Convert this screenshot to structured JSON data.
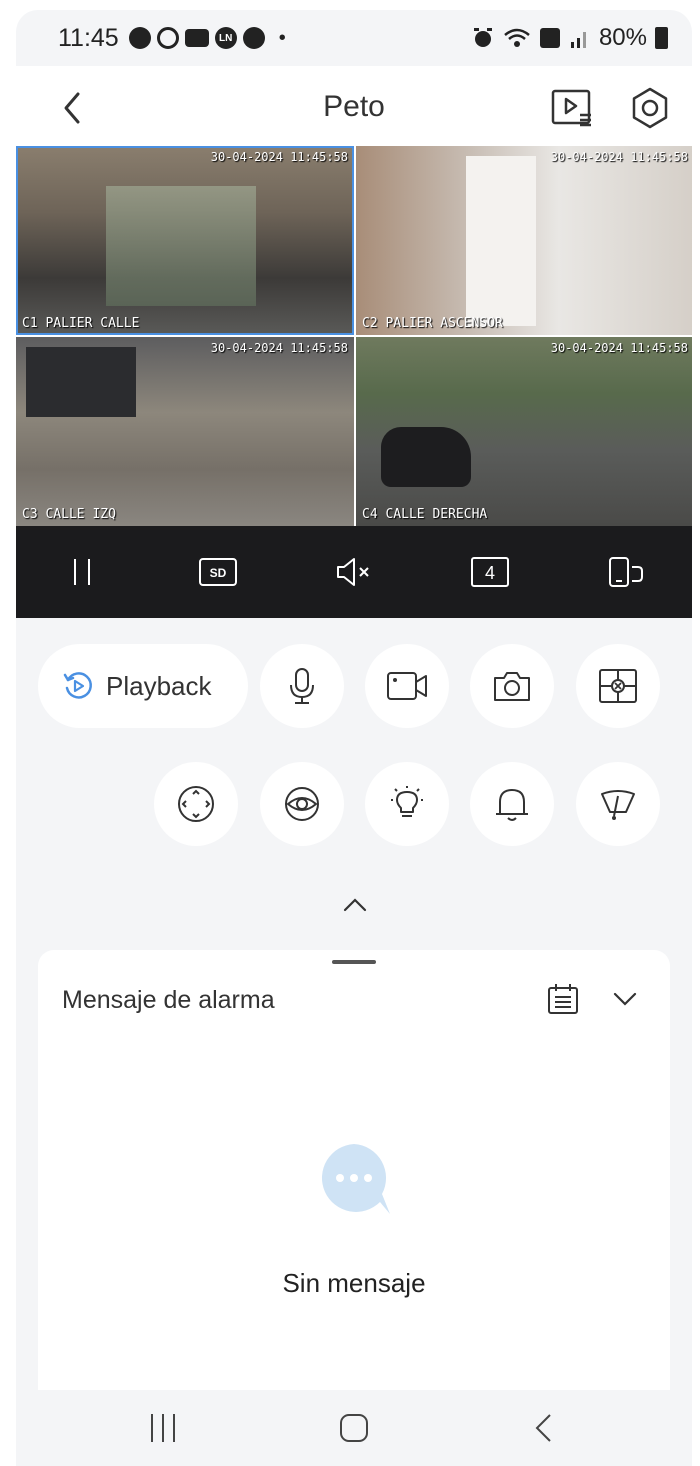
{
  "status_bar": {
    "time": "11:45",
    "battery": "80%",
    "icons": [
      "chat-icon",
      "cloud-icon",
      "youtube-icon",
      "ln-icon",
      "settings-icon",
      "alarm-icon",
      "wifi-icon",
      "volte-icon",
      "signal-icon",
      "battery-icon"
    ],
    "ln_label": "LN",
    "dot": "•"
  },
  "header": {
    "title": "Peto"
  },
  "cameras": [
    {
      "label": "C1 PALIER CALLE",
      "timestamp": "30-04-2024 11:45:58",
      "selected": true
    },
    {
      "label": "C2 PALIER ASCENSOR",
      "timestamp": "30-04-2024 11:45:58",
      "selected": false
    },
    {
      "label": "C3 CALLE IZQ",
      "timestamp": "30-04-2024 11:45:58",
      "selected": false
    },
    {
      "label": "C4 CALLE DERECHA",
      "timestamp": "30-04-2024 11:45:58",
      "selected": false
    }
  ],
  "video_toolbar": {
    "quality": "SD",
    "split_count": "4"
  },
  "actions": {
    "playback_label": "Playback"
  },
  "alarm_panel": {
    "title": "Mensaje de alarma",
    "empty_text": "Sin mensaje"
  },
  "colors": {
    "accent": "#4a90e2",
    "toolbar_bg": "#1b1b1d",
    "page_bg": "#f4f5f7",
    "empty_icon": "#cfe3f5"
  }
}
